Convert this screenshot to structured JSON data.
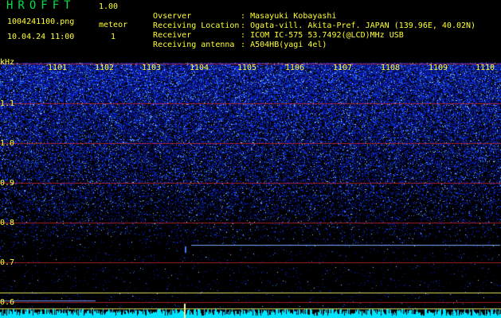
{
  "header": {
    "app_title": "HROFFT",
    "version": "1.00",
    "filename": "1004241100.png",
    "meteor_label": "meteor",
    "datetime": "10.04.24 11:00",
    "meteor_count": "1"
  },
  "info": [
    {
      "key": "Ovserver",
      "value": "Masayuki Kobayashi"
    },
    {
      "key": "Receiving Location",
      "value": "Ogata-vill. Akita-Pref. JAPAN (139.96E, 40.02N)"
    },
    {
      "key": "Receiver",
      "value": "ICOM IC-575 53.7492(@LCD)MHz USB"
    },
    {
      "key": "Receiving antenna",
      "value": "A504HB(yagi 4el)"
    }
  ],
  "axis": {
    "unit": "kHz",
    "freq_ticks": [
      "1.1",
      "1.0",
      "0.9",
      "0.8",
      "0.7",
      "0.6"
    ],
    "time_ticks": [
      "1101",
      "1102",
      "1103",
      "1104",
      "1105",
      "1106",
      "1107",
      "1108",
      "1109",
      "1110"
    ]
  },
  "colors": {
    "text_yellow": "#ffff33",
    "title_green": "#00e04a",
    "noise_blue": "#2a50ff",
    "signal_cyan": "#00ffff",
    "grid_red": "#ff0000"
  }
}
